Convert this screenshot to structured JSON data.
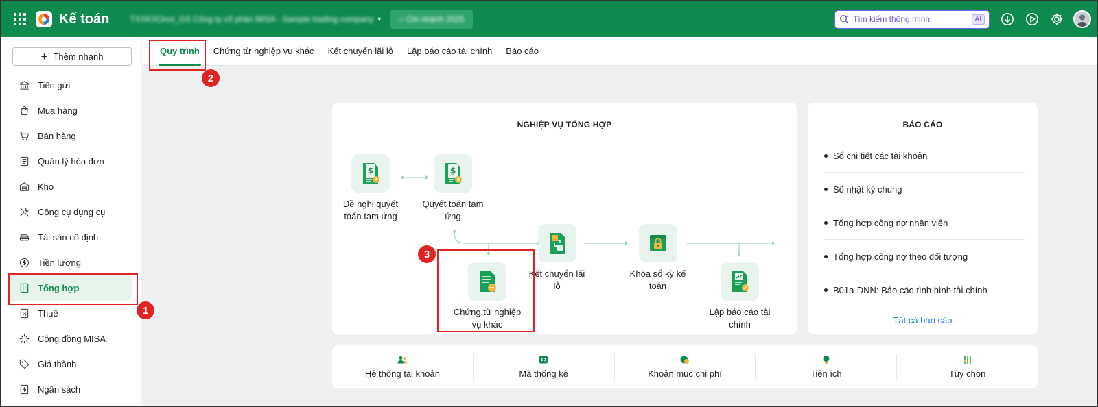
{
  "app": {
    "title": "Kế toán",
    "company": "TXXKXOnoi_GS Công ty cổ phần MISA - Sample trading company",
    "period": "○ Chi nhánh 2025"
  },
  "search": {
    "placeholder": "Tìm kiếm thông minh",
    "ai_badge": "AI"
  },
  "sidebar": {
    "quick_add": "Thêm nhanh",
    "items": [
      {
        "label": "Tiền gửi",
        "icon": "bank-icon"
      },
      {
        "label": "Mua hàng",
        "icon": "shopping-bag-icon"
      },
      {
        "label": "Bán hàng",
        "icon": "cart-icon"
      },
      {
        "label": "Quản lý hóa đơn",
        "icon": "invoice-icon"
      },
      {
        "label": "Kho",
        "icon": "warehouse-icon"
      },
      {
        "label": "Công cụ dụng cụ",
        "icon": "tools-icon"
      },
      {
        "label": "Tài sản cố định",
        "icon": "car-icon"
      },
      {
        "label": "Tiền lương",
        "icon": "dollar-circle-icon"
      },
      {
        "label": "Tổng hợp",
        "icon": "ledger-icon",
        "active": true
      },
      {
        "label": "Thuế",
        "icon": "tax-icon"
      },
      {
        "label": "Cộng đồng MISA",
        "icon": "community-icon"
      },
      {
        "label": "Giá thành",
        "icon": "tag-icon"
      },
      {
        "label": "Ngân sách",
        "icon": "budget-icon"
      }
    ]
  },
  "tabs": [
    {
      "label": "Quy trình",
      "active": true
    },
    {
      "label": "Chứng từ nghiệp vụ khác"
    },
    {
      "label": "Kết chuyển lãi lỗ"
    },
    {
      "label": "Lập báo cáo tài chính"
    },
    {
      "label": "Báo cáo"
    }
  ],
  "workflow": {
    "title": "NGHIỆP VỤ TỔNG HỢP",
    "nodes": {
      "advance_request": "Đề nghị quyết toán tạm ứng",
      "advance_settlement": "Quyết toán tạm ứng",
      "other_vouchers": "Chứng từ nghiệp vụ khác",
      "profit_transfer": "Kết chuyển lãi lỗ",
      "period_lock": "Khóa sổ kỳ kế toán",
      "financial_report": "Lập báo cáo tài chính"
    }
  },
  "reports": {
    "title": "BÁO CÁO",
    "items": [
      "Sổ chi tiết các tài khoản",
      "Sổ nhật ký chung",
      "Tổng hợp công nợ nhân viên",
      "Tổng hợp công nợ theo đối tượng",
      "B01a-DNN: Báo cáo tình hình tài chính"
    ],
    "all_link": "Tất cả báo cáo"
  },
  "bottom_bar": [
    {
      "label": "Hệ thống tài khoản",
      "icon": "users-icon"
    },
    {
      "label": "Mã thống kê",
      "icon": "code-icon"
    },
    {
      "label": "Khoản mục chi phí",
      "icon": "cost-icon"
    },
    {
      "label": "Tiện ích",
      "icon": "bulb-icon"
    },
    {
      "label": "Tùy chọn",
      "icon": "sliders-icon"
    }
  ],
  "annotations": [
    "1",
    "2",
    "3"
  ],
  "colors": {
    "brand": "#0f8a4f",
    "highlight": "#e02424",
    "link": "#1f7be0",
    "ai": "#6a5bd8"
  }
}
